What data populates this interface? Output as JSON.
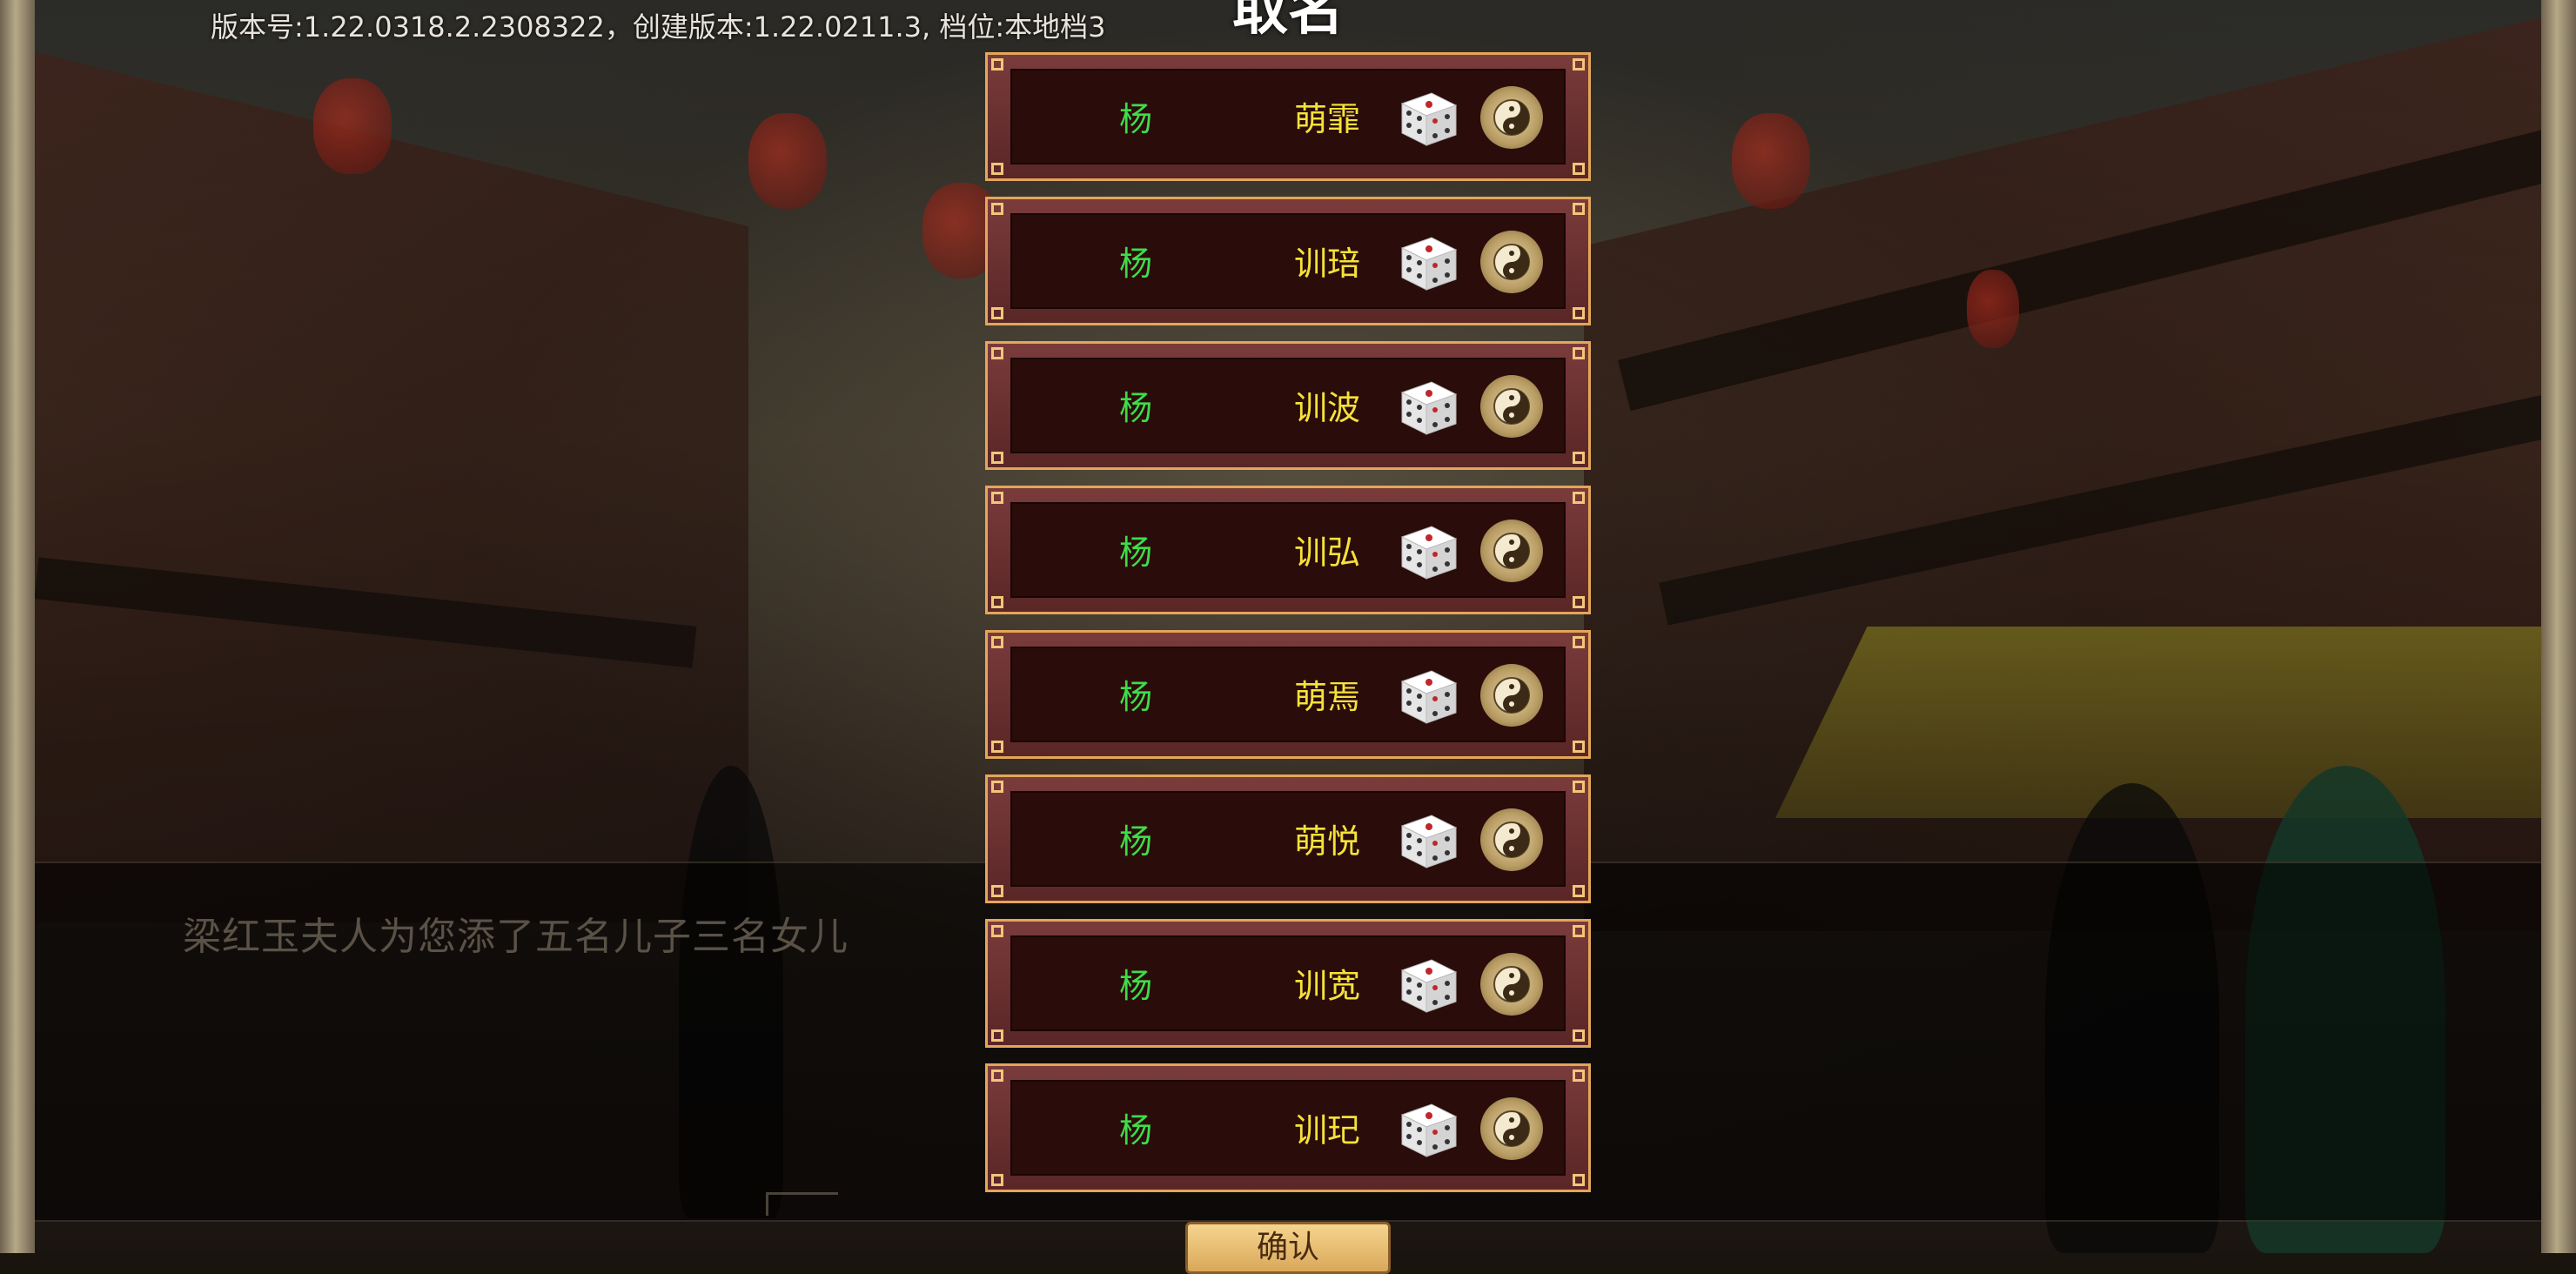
{
  "version_info": "版本号:1.22.0318.2.2308322，创建版本:1.22.0211.3, 档位:本地档3",
  "title": "取名",
  "dialogue": "梁红玉夫人为您添了五名儿子三名女儿",
  "confirm_label": "确认",
  "colors": {
    "surname": "#3fdc4a",
    "given": "#f5e23a",
    "frame": "#e3a65a"
  },
  "names": [
    {
      "surname": "杨",
      "given": "萌霏"
    },
    {
      "surname": "杨",
      "given": "训琣"
    },
    {
      "surname": "杨",
      "given": "训波"
    },
    {
      "surname": "杨",
      "given": "训弘"
    },
    {
      "surname": "杨",
      "given": "萌焉"
    },
    {
      "surname": "杨",
      "given": "萌悦"
    },
    {
      "surname": "杨",
      "given": "训宽"
    },
    {
      "surname": "杨",
      "given": "训玘"
    }
  ],
  "icons": {
    "random": "dice-icon",
    "fortune": "yinyang-icon"
  }
}
